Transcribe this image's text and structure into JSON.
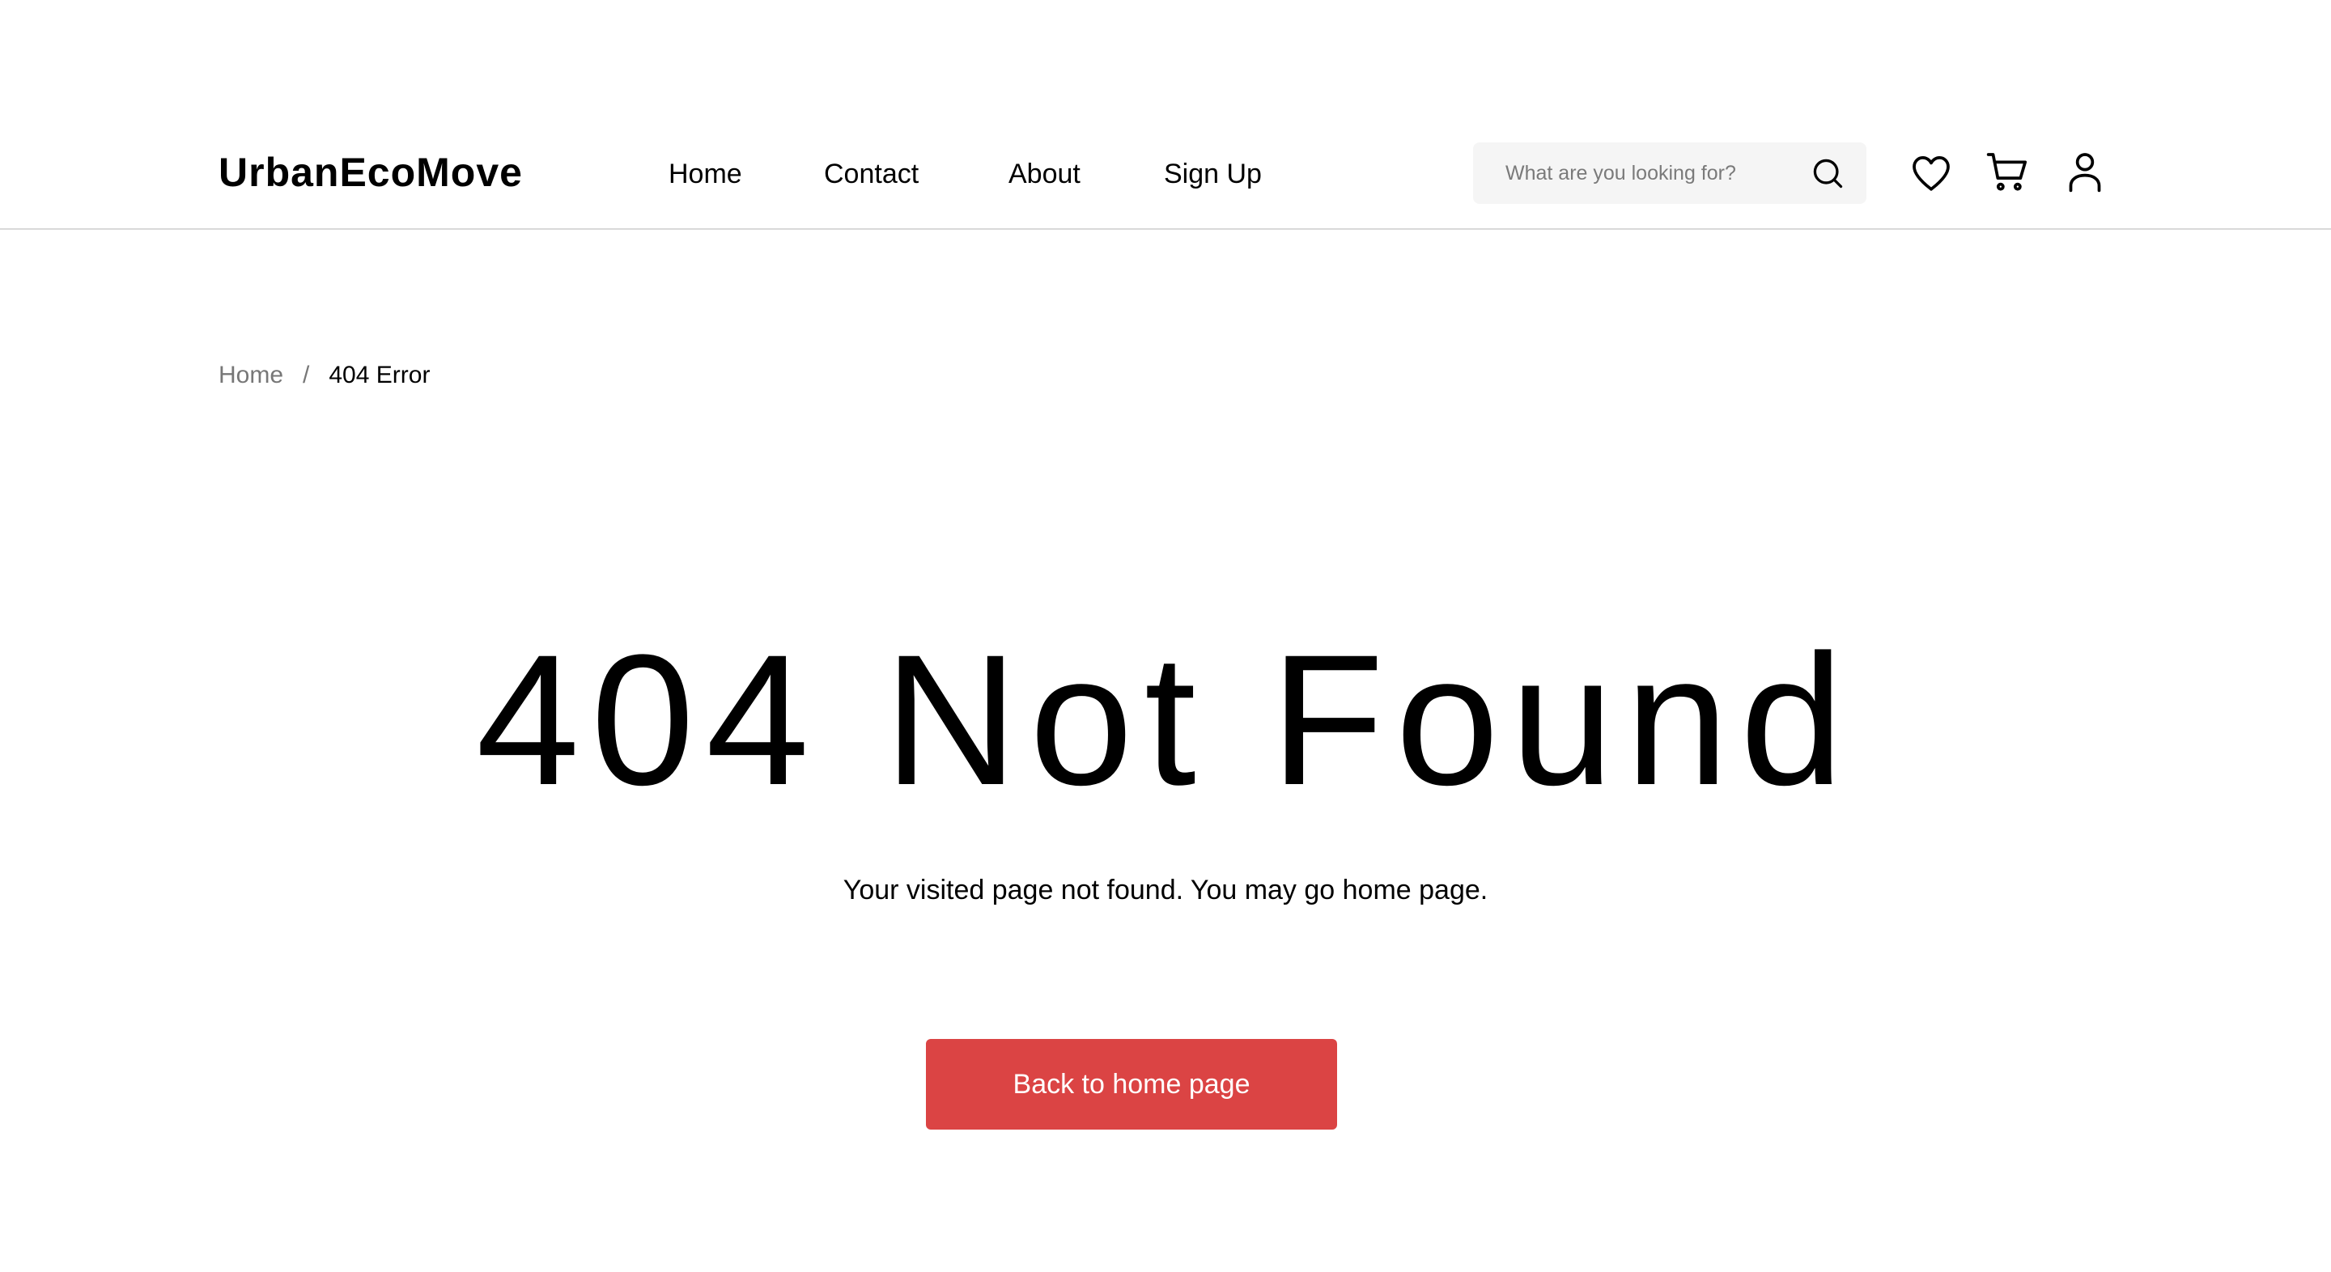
{
  "header": {
    "logo": "UrbanEcoMove",
    "nav": [
      {
        "label": "Home"
      },
      {
        "label": "Contact"
      },
      {
        "label": "About"
      },
      {
        "label": "Sign Up"
      }
    ],
    "search": {
      "placeholder": "What are you looking for?",
      "icon": "search-icon"
    },
    "icons": [
      "heart-icon",
      "cart-icon",
      "user-icon"
    ]
  },
  "breadcrumb": {
    "home": "Home",
    "separator": "/",
    "current": "404 Error"
  },
  "main": {
    "title": "404 Not Found",
    "message": "Your visited page not found. You may go home page.",
    "button_label": "Back to home page"
  },
  "colors": {
    "accent": "#db4444",
    "search_bg": "#f5f5f5",
    "muted_text": "#777777",
    "divider": "#d9d9d9"
  }
}
